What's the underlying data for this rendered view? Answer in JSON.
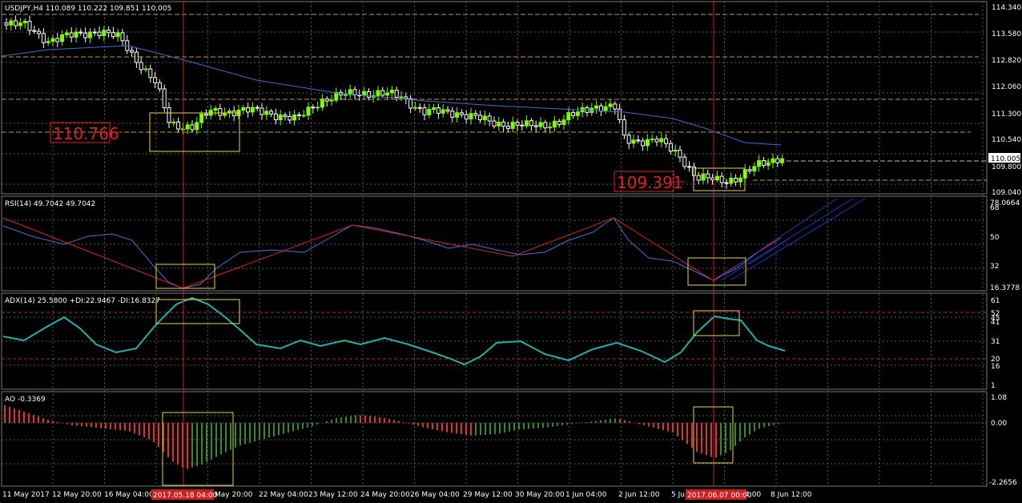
{
  "main": {
    "header": "USDJPY,H4  110.089 110.222 109.851 110.005",
    "y_ticks": [
      "114.340",
      "113.580",
      "112.820",
      "112.060",
      "111.300",
      "110.540",
      "109.800",
      "109.040"
    ],
    "current_price": "110.005",
    "annotation_high": "110.766",
    "annotation_low": "109.391"
  },
  "rsi": {
    "header": "RSI(14) 49.7042 49.7042",
    "ticks": [
      "78.0664",
      "68",
      "50",
      "32",
      "16.3778"
    ]
  },
  "adx": {
    "header": "ADX(14) 25.5800 +DI:22.9467 -DI:16.8327",
    "ticks": [
      "61",
      "52",
      "45",
      "41",
      "31",
      "20",
      "16",
      "1"
    ]
  },
  "ao": {
    "header": "AO -0.3369",
    "ticks": [
      "1.08",
      "0.00",
      "-2.2656"
    ]
  },
  "x_axis": {
    "labels": [
      "11 May 2017",
      "12 May 20:00",
      "16 May 04:00",
      "May 20:00",
      "22 May 04:00",
      "23 May 12:00",
      "24 May 20:00",
      "26 May 04:00",
      "29 May 12:00",
      "30 May 20:00",
      "1 Jun 04:00",
      "2 Jun 12:00",
      "5 Ju",
      "4:00",
      "8 Jun 12:00"
    ],
    "highlight_1": "2017.05.18 04:00",
    "highlight_2": "2017.06.07 00:00"
  },
  "colors": {
    "background": "#000000",
    "grid": "#5a5a5a",
    "bull_candle": "#7cfc00",
    "bear_candle": "#ffffff",
    "ma_line": "#3b6fd8",
    "rsi_line": "#4a6fd4",
    "adx_line": "#20b2aa",
    "trend_line": "#e02020",
    "hline": "#c89a2a",
    "box": "#e8d44d",
    "ao_up": "#2e8b2e",
    "ao_down": "#e03030",
    "price_label_bg": "#ffffff"
  }
}
